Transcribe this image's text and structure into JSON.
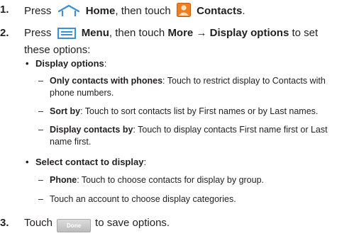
{
  "steps": [
    {
      "num": "1.",
      "a": "Press",
      "home": "Home",
      "b": ", then touch",
      "contacts": "Contacts",
      "end": "."
    },
    {
      "num": "2.",
      "a": "Press",
      "menu": "Menu",
      "b": ", then touch",
      "more": "More",
      "arrow": "→",
      "display_options": "Display options",
      "c": "to set these options:"
    },
    {
      "num": "3.",
      "a": "Touch",
      "done_button": "Done",
      "b": "to save options."
    }
  ],
  "bullets": [
    {
      "label": "Display options",
      "colon": ":",
      "items": [
        {
          "term": "Only contacts with phones",
          "text": ": Touch to restrict display to Contacts with phone numbers."
        },
        {
          "term": "Sort by",
          "text": ": Touch to sort contacts list by First names or by Last names."
        },
        {
          "term": "Display contacts by",
          "text": ": Touch to display contacts First name first or Last name first."
        }
      ]
    },
    {
      "label": "Select contact to display",
      "colon": ":",
      "items": [
        {
          "term": "Phone",
          "text": ": Touch to choose contacts for display by group."
        },
        {
          "term": "",
          "text": "Touch an account to choose display categories."
        }
      ]
    }
  ],
  "icons": {
    "home": "home-icon",
    "contacts": "contacts-icon",
    "menu": "menu-icon"
  },
  "colors": {
    "contacts_icon": "#f07f22",
    "home_icon": "#3d8fd6",
    "done_button": "#c8c8c8"
  }
}
